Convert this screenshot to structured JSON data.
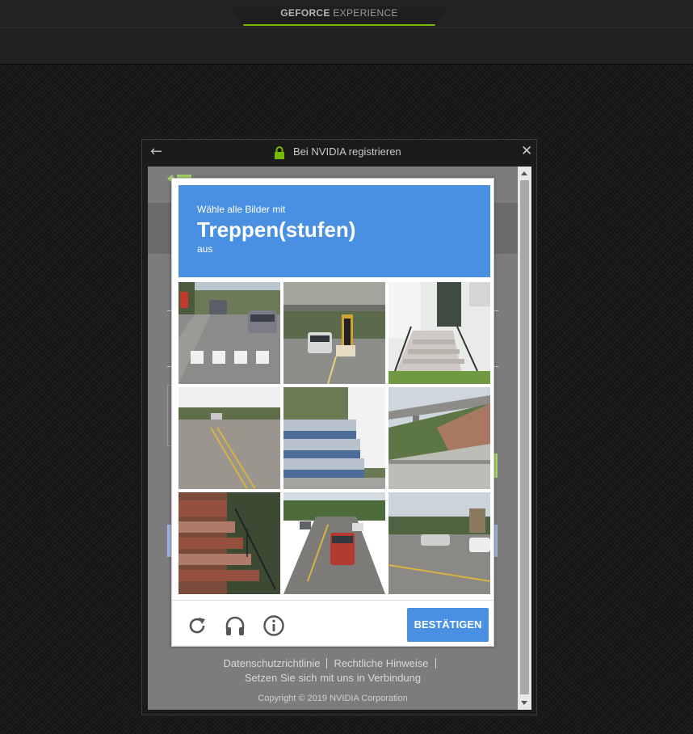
{
  "app": {
    "logo_bold": "GEFORCE",
    "logo_rest": "EXPERIENCE"
  },
  "dialog": {
    "title": "Bei NVIDIA registrieren"
  },
  "captcha": {
    "instruction_prefix": "Wähle alle Bilder mit",
    "target": "Treppen(stufen)",
    "instruction_suffix": "aus",
    "verify_label": "BESTÄTIGEN",
    "tiles": [
      "street-crosswalk",
      "overpass-truck",
      "house-steps",
      "empty-road",
      "blue-steps",
      "bridge-embankment",
      "brick-steps",
      "road-traffic",
      "road-intersection"
    ]
  },
  "footer": {
    "privacy": "Datenschutzrichtlinie",
    "legal": "Rechtliche Hinweise",
    "contact": "Setzen Sie sich mit uns in Verbindung",
    "copyright": "Copyright © 2019 NVIDIA Corporation"
  },
  "colors": {
    "accent": "#76b900",
    "captcha_blue": "#4a90e2"
  },
  "icons": [
    "back-arrow-icon",
    "lock-icon",
    "close-icon",
    "reload-icon",
    "headphones-icon",
    "info-icon"
  ]
}
